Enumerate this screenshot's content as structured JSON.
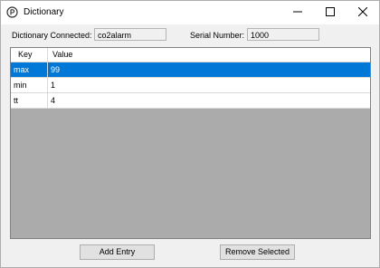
{
  "window": {
    "title": "Dictionary"
  },
  "info": {
    "connected_label": "Dictionary Connected:",
    "connected_value": "co2alarm",
    "serial_label": "Serial Number:",
    "serial_value": "1000"
  },
  "grid": {
    "columns": [
      "Key",
      "Value"
    ],
    "rows": [
      {
        "key": "max",
        "value": "99",
        "selected": true
      },
      {
        "key": "min",
        "value": "1",
        "selected": false
      },
      {
        "key": "tt",
        "value": "4",
        "selected": false
      }
    ]
  },
  "buttons": {
    "add": "Add Entry",
    "remove": "Remove Selected"
  },
  "colors": {
    "selection": "#0078d7",
    "grid_background": "#ababab"
  },
  "icons": [
    "app-icon",
    "minimize-icon",
    "maximize-icon",
    "close-icon"
  ]
}
